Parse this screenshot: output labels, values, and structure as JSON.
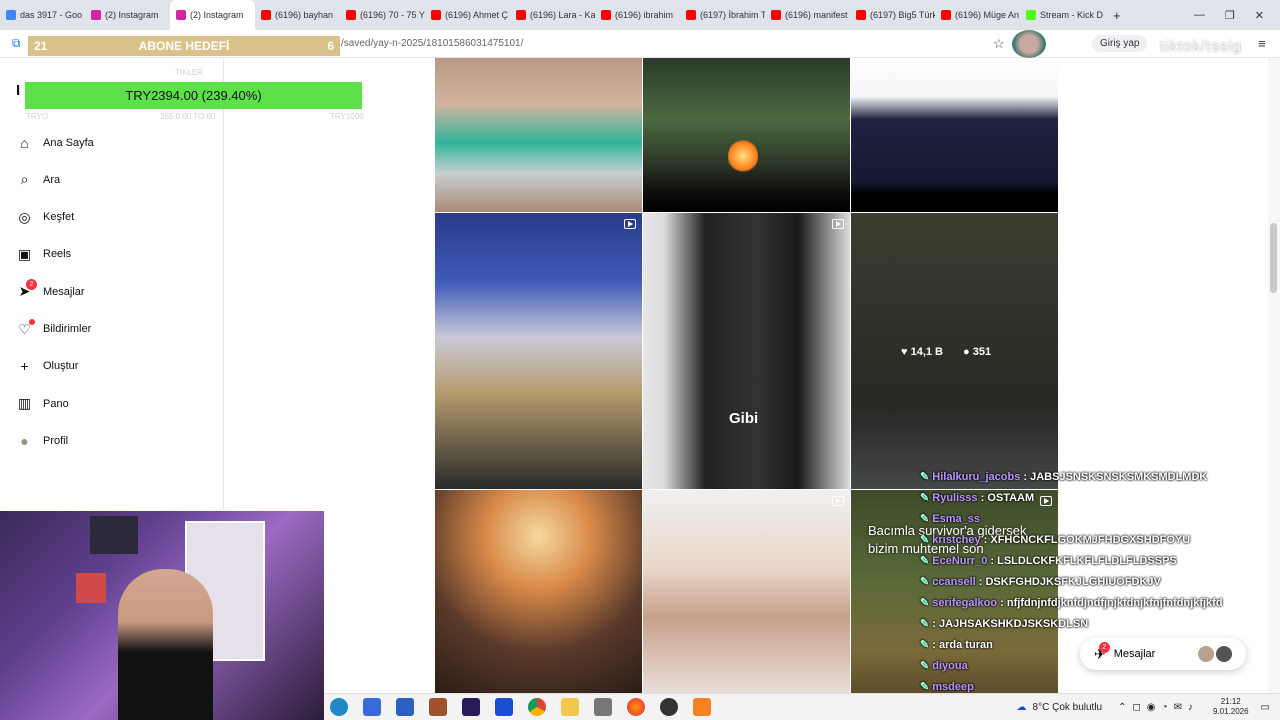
{
  "browser": {
    "tabs": [
      {
        "label": "das 3917 - Goo",
        "color": "#4285f4"
      },
      {
        "label": "(2) Instagram",
        "color": "#d6249f"
      },
      {
        "label": "(2) Instagram",
        "color": "#d6249f",
        "active": true
      },
      {
        "label": "(6196) bayhan",
        "color": "#ff0000"
      },
      {
        "label": "(6196) 70 - 75 Y",
        "color": "#ff0000"
      },
      {
        "label": "(6196) Ahmet Ç",
        "color": "#ff0000"
      },
      {
        "label": "(6196) Lara - Ka",
        "color": "#ff0000"
      },
      {
        "label": "(6196) ibrahim",
        "color": "#ff0000"
      },
      {
        "label": "(6197) İbrahim T",
        "color": "#ff0000"
      },
      {
        "label": "(6196) manifest",
        "color": "#ff0000"
      },
      {
        "label": "(6197) Big5 Türk",
        "color": "#ff0000"
      },
      {
        "label": "(6196) Müge An",
        "color": "#ff0000"
      },
      {
        "label": "Stream - Kick D",
        "color": "#53fc18"
      }
    ],
    "new_tab": "+",
    "url": "/saved/yay-n-2025/18101586031475101/",
    "login_label": "Giriş yap",
    "watermark": "tiktok/tssig"
  },
  "overlay": {
    "goal_current": "21",
    "goal_label": "ABONE HEDEFİ",
    "goal_target": "6",
    "donation": "TRY2394.00 (239.40%)",
    "ghost_top": "TİKLER",
    "ghost_left": "TRYO",
    "ghost_mid": "265 0.00 TO 60",
    "ghost_right": "TRY1000"
  },
  "sidebar": {
    "items": [
      {
        "label": "Ana Sayfa",
        "icon": "home-icon"
      },
      {
        "label": "Ara",
        "icon": "search-icon"
      },
      {
        "label": "Keşfet",
        "icon": "compass-icon"
      },
      {
        "label": "Reels",
        "icon": "reels-icon"
      },
      {
        "label": "Mesajlar",
        "icon": "messenger-icon",
        "badge": "2"
      },
      {
        "label": "Bildirimler",
        "icon": "heart-icon"
      },
      {
        "label": "Oluştur",
        "icon": "plus-icon"
      },
      {
        "label": "Pano",
        "icon": "dashboard-icon"
      },
      {
        "label": "Profil",
        "icon": "avatar"
      }
    ]
  },
  "grid": {
    "likes": "14,1 B",
    "comments": "351",
    "caption_gibi": "Gibi"
  },
  "chat": [
    {
      "user": "Hilalkuru_jacobs",
      "text": "JABSJSNSKSNSKSMKSMDLMDK"
    },
    {
      "user": "Ryulisss",
      "text": "OSTAAM"
    },
    {
      "user": "Esma_ss",
      "text": ""
    },
    {
      "user": "kristchey",
      "text": "XFHCNCKFLGOKMJFHDGXSHDFOYU"
    },
    {
      "user": "EceNurr_0",
      "text": "LSLDLCKFKFLKFLFLDLFLDSSPS"
    },
    {
      "user": "ccansell",
      "text": "DSKFGHDJKSFKJLGHIUOFDKJV"
    },
    {
      "user": "serifegalkoo",
      "text": "nfjfdnjnfdjknfdjndfjnjkfdnjkfnjfnfdnjkfjkfd"
    },
    {
      "user": "",
      "text": "JAJHSAKSHKDJSKSKDLSN"
    },
    {
      "user": "",
      "text": "arda turan"
    },
    {
      "user": "diyoua",
      "text": ""
    },
    {
      "user": "msdeep",
      "text": ""
    }
  ],
  "subtitle": "Bacımla survivor'a gidersek bizim muhtemel son",
  "messages_pill": {
    "label": "Mesajlar",
    "badge": "2"
  },
  "taskbar": {
    "weather": "8°C  Çok bulutlu",
    "time": "21:12",
    "date": "9.01.2026"
  }
}
